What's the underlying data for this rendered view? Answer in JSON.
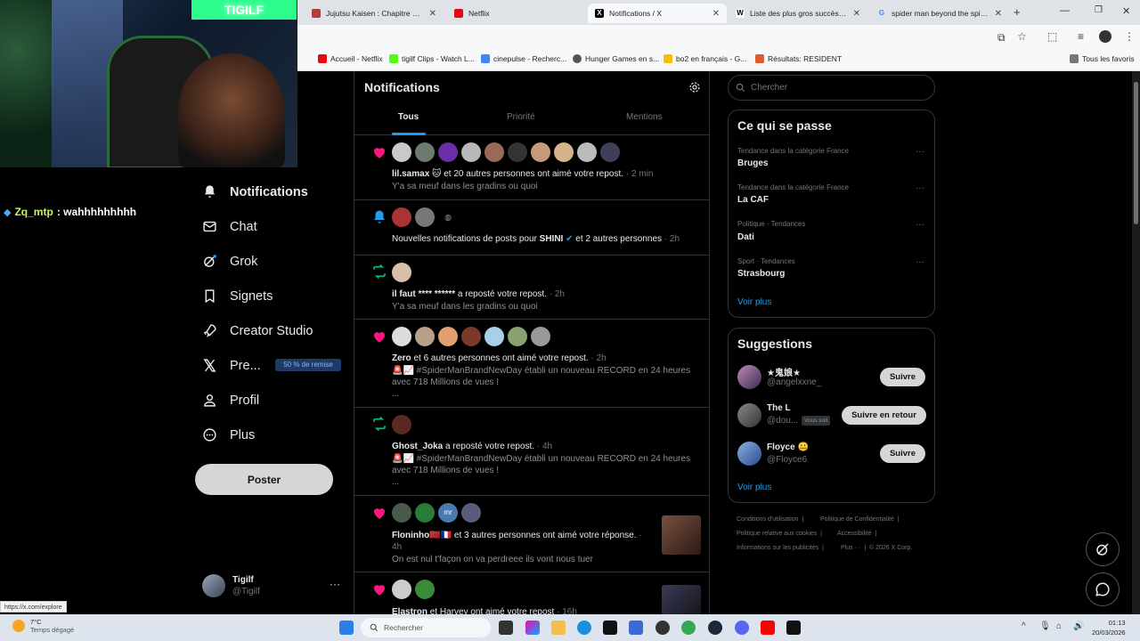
{
  "browser": {
    "tabs": [
      {
        "label": "Jujutsu Kaisen : Chapitre 173 -",
        "color": "#b83a3a",
        "glyph": ""
      },
      {
        "label": "Netflix",
        "color": "#e50914",
        "glyph": ""
      },
      {
        "label": "Notifications / X",
        "color": "#000000",
        "glyph": "X"
      },
      {
        "label": "Liste des plus gros succès du d",
        "color": "#ffffff",
        "glyph": "W"
      },
      {
        "label": "spider man beyond the spider",
        "color": "#4285f4",
        "glyph": "G"
      }
    ],
    "bookmarks": [
      {
        "label": "Accueil - Netflix",
        "color": "#e50914"
      },
      {
        "label": "tigilf Clips - Watch L...",
        "color": "#53fc18"
      },
      {
        "label": "cinepulse - Recherc...",
        "color": "#4285f4"
      },
      {
        "label": "Hunger Games en s...",
        "color": "#555555"
      },
      {
        "label": "bo2 en français - G...",
        "color": "#fbbc05"
      },
      {
        "label": "Résultats: RESIDENT",
        "color": "#e35a2a"
      },
      {
        "label": "Tous les favoris",
        "color": "#777777"
      }
    ]
  },
  "stream": {
    "neon_text": "TIGILF",
    "chat_user": "Zq_mtp",
    "chat_message": ": wahhhhhhhhh"
  },
  "nav": {
    "items": [
      {
        "label": "Notifications",
        "icon": "bell-icon"
      },
      {
        "label": "Chat",
        "icon": "mail-icon"
      },
      {
        "label": "Grok",
        "icon": "grok-icon"
      },
      {
        "label": "Signets",
        "icon": "bookmark-icon"
      },
      {
        "label": "Creator Studio",
        "icon": "rocket-icon"
      },
      {
        "label": "Pre...",
        "icon": "x-logo-icon"
      },
      {
        "label": "Profil",
        "icon": "person-icon"
      },
      {
        "label": "Plus",
        "icon": "more-circle-icon"
      }
    ],
    "premium_badge": "50 % de remise",
    "post_button": "Poster",
    "account": {
      "name": "Tigilf",
      "handle": "@Tigilf"
    }
  },
  "main": {
    "title": "Notifications",
    "tabs": [
      "Tous",
      "Priorité",
      "Mentions"
    ],
    "notifications": [
      {
        "type": "like",
        "actor": "lil.samax",
        "actor_suffix": " 🐱",
        "text": " et 20 autres personnes ont aimé votre repost.",
        "time": "· 2 min",
        "sub": "Y'a sa meuf dans les gradins ou quoi"
      },
      {
        "type": "bell",
        "prefix": "Nouvelles notifications de posts pour ",
        "actor": "SHINI",
        "text": " et 2 autres personnes",
        "time": "· 2h",
        "sub": ""
      },
      {
        "type": "repost",
        "actor": "il faut **** ******",
        "text": " a reposté votre repost.",
        "time": "· 2h",
        "sub": "Y'a sa meuf dans les gradins ou quoi"
      },
      {
        "type": "like",
        "actor": "Zero",
        "text": " et 6 autres personnes ont aimé votre repost.",
        "time": "· 2h",
        "sub": "🚨📈 #SpiderManBrandNewDay établi un nouveau RECORD en 24 heures avec 718 Millions de vues !",
        "sub2": "..."
      },
      {
        "type": "repost",
        "actor": "Ghost_Joka",
        "text": " a reposté votre repost.",
        "time": "· 4h",
        "sub": "🚨📈 #SpiderManBrandNewDay établi un nouveau RECORD en 24 heures avec 718 Millions de vues !",
        "sub2": "..."
      },
      {
        "type": "like",
        "actor": "Floninho",
        "actor_suffix": "🇲🇦🇫🇷",
        "text": " et 3 autres personnes ont aimé votre réponse.",
        "time": "· 4h",
        "sub": "On est nul t'façon on va perdreee ils vont nous tuer"
      },
      {
        "type": "like",
        "actor": "Elastron",
        "text": " et Harvey ont aimé votre repost",
        "time": "· 16h",
        "sub": ""
      }
    ]
  },
  "right": {
    "search_placeholder": "Chercher",
    "trends_title": "Ce qui se passe",
    "trends": [
      {
        "meta": "Tendance dans la catégorie France",
        "name": "Bruges"
      },
      {
        "meta": "Tendance dans la catégorie France",
        "name": "La CAF"
      },
      {
        "meta": "Politique · Tendances",
        "name": "Dati"
      },
      {
        "meta": "Sport · Tendances",
        "name": "Strasbourg"
      }
    ],
    "trends_more": "Voir plus",
    "suggestions_title": "Suggestions",
    "suggestions": [
      {
        "name": "★鬼娘★",
        "handle": "@angelxxne_",
        "button": "Suivre"
      },
      {
        "name": "The L",
        "handle": "@dou...",
        "button": "Suivre en retour",
        "badge": "Vous suit"
      },
      {
        "name": "Floyce 🤐",
        "handle": "@Floyce6",
        "button": "Suivre"
      }
    ],
    "suggestions_more": "Voir plus",
    "footer": {
      "line1a": "Conditions d'utilisation",
      "line1b": "Politique de Confidentialité",
      "line2a": "Politique relative aux cookies",
      "line2b": "Accessibilité",
      "line3a": "Informations sur les publicités",
      "line3b": "Plus ···",
      "line3c": "© 2026 X Corp."
    }
  },
  "status_url": "https://x.com/explore",
  "taskbar": {
    "temp": "7°C",
    "weather": "Temps dégagé",
    "search": "Rechercher",
    "time": "01:13",
    "date": "20/03/2026"
  },
  "colors": {
    "accent": "#1d9bf0",
    "like": "#f91880",
    "repost": "#00ba7c",
    "background": "#000000"
  }
}
